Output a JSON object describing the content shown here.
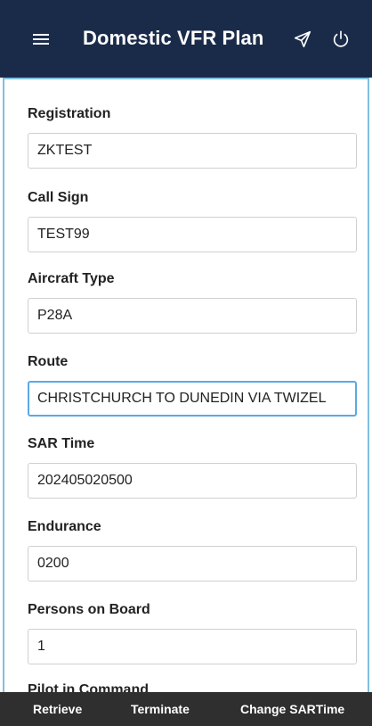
{
  "header": {
    "title": "Domestic VFR Plan",
    "menu_icon": "hamburger-menu-icon",
    "send_icon": "send-icon",
    "power_icon": "power-icon",
    "background_color": "#1a2b4a"
  },
  "form": {
    "fields": [
      {
        "label": "Registration",
        "value": "ZKTEST"
      },
      {
        "label": "Call Sign",
        "value": "TEST99"
      },
      {
        "label": "Aircraft Type",
        "value": "P28A"
      },
      {
        "label": "Route",
        "value": "CHRISTCHURCH TO DUNEDIN VIA TWIZEL"
      },
      {
        "label": "SAR Time",
        "value": "202405020500"
      },
      {
        "label": "Endurance",
        "value": "0200"
      },
      {
        "label": "Persons on Board",
        "value": "1"
      },
      {
        "label": "Pilot in Command",
        "value": ""
      }
    ],
    "focus_color": "#5aa9e6",
    "frame_color": "#7fc0e0"
  },
  "actions": {
    "retrieve": "Retrieve",
    "terminate": "Terminate",
    "change_sartime": "Change SARTime",
    "background_color": "#2f2f2f"
  }
}
